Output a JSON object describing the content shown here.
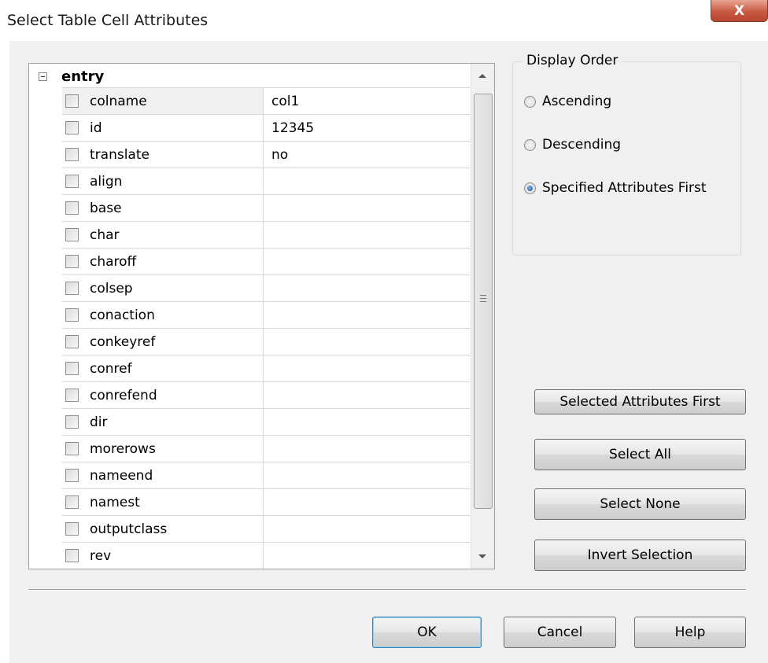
{
  "window": {
    "title": "Select Table Cell Attributes",
    "close_glyph": "X"
  },
  "grid": {
    "root_label": "entry",
    "rows": [
      {
        "name": "colname",
        "value": "col1"
      },
      {
        "name": "id",
        "value": "12345"
      },
      {
        "name": "translate",
        "value": "no"
      },
      {
        "name": "align",
        "value": ""
      },
      {
        "name": "base",
        "value": ""
      },
      {
        "name": "char",
        "value": ""
      },
      {
        "name": "charoff",
        "value": ""
      },
      {
        "name": "colsep",
        "value": ""
      },
      {
        "name": "conaction",
        "value": ""
      },
      {
        "name": "conkeyref",
        "value": ""
      },
      {
        "name": "conref",
        "value": ""
      },
      {
        "name": "conrefend",
        "value": ""
      },
      {
        "name": "dir",
        "value": ""
      },
      {
        "name": "morerows",
        "value": ""
      },
      {
        "name": "nameend",
        "value": ""
      },
      {
        "name": "namest",
        "value": ""
      },
      {
        "name": "outputclass",
        "value": ""
      },
      {
        "name": "rev",
        "value": ""
      }
    ]
  },
  "display_order": {
    "legend": "Display Order",
    "options": [
      {
        "label": "Ascending",
        "checked": false
      },
      {
        "label": "Descending",
        "checked": false
      },
      {
        "label": "Specified Attributes First",
        "checked": true
      }
    ]
  },
  "actions": {
    "selected_first": "Selected Attributes First",
    "select_all": "Select All",
    "select_none": "Select None",
    "invert": "Invert Selection"
  },
  "footer": {
    "ok": "OK",
    "cancel": "Cancel",
    "help": "Help"
  },
  "colors": {
    "dialog_bg": "#f0f0f0",
    "close_button": "#c85a43",
    "default_button_border": "#3c7fb1"
  }
}
